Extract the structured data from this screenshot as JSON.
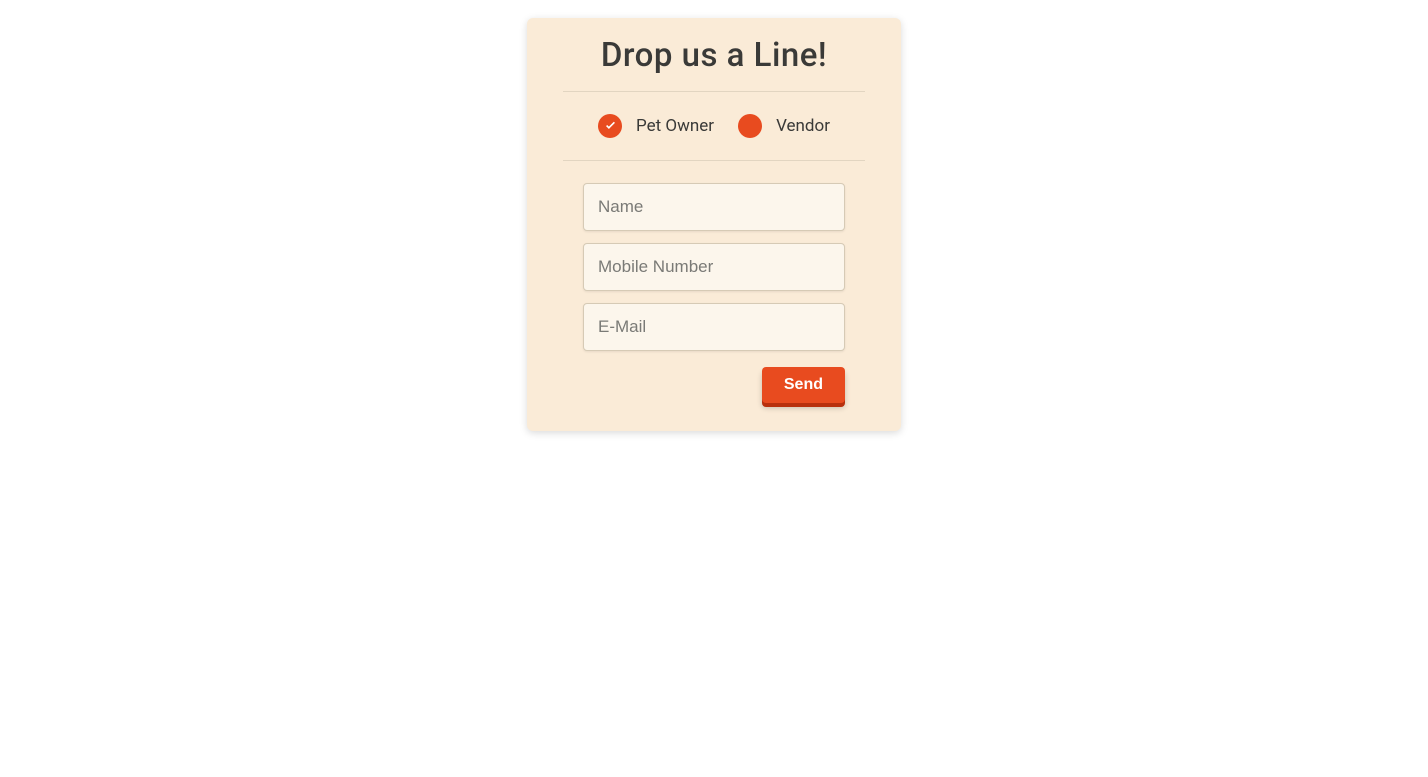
{
  "form": {
    "title": "Drop us a Line!",
    "radios": [
      {
        "label": "Pet Owner",
        "checked": true
      },
      {
        "label": "Vendor",
        "checked": false
      }
    ],
    "fields": {
      "name_placeholder": "Name",
      "mobile_placeholder": "Mobile Number",
      "email_placeholder": "E-Mail"
    },
    "submit_label": "Send"
  },
  "colors": {
    "card_bg": "#faebd7",
    "accent": "#e84b1f",
    "text": "#3a3a38",
    "input_bg": "#fcf6ec"
  }
}
